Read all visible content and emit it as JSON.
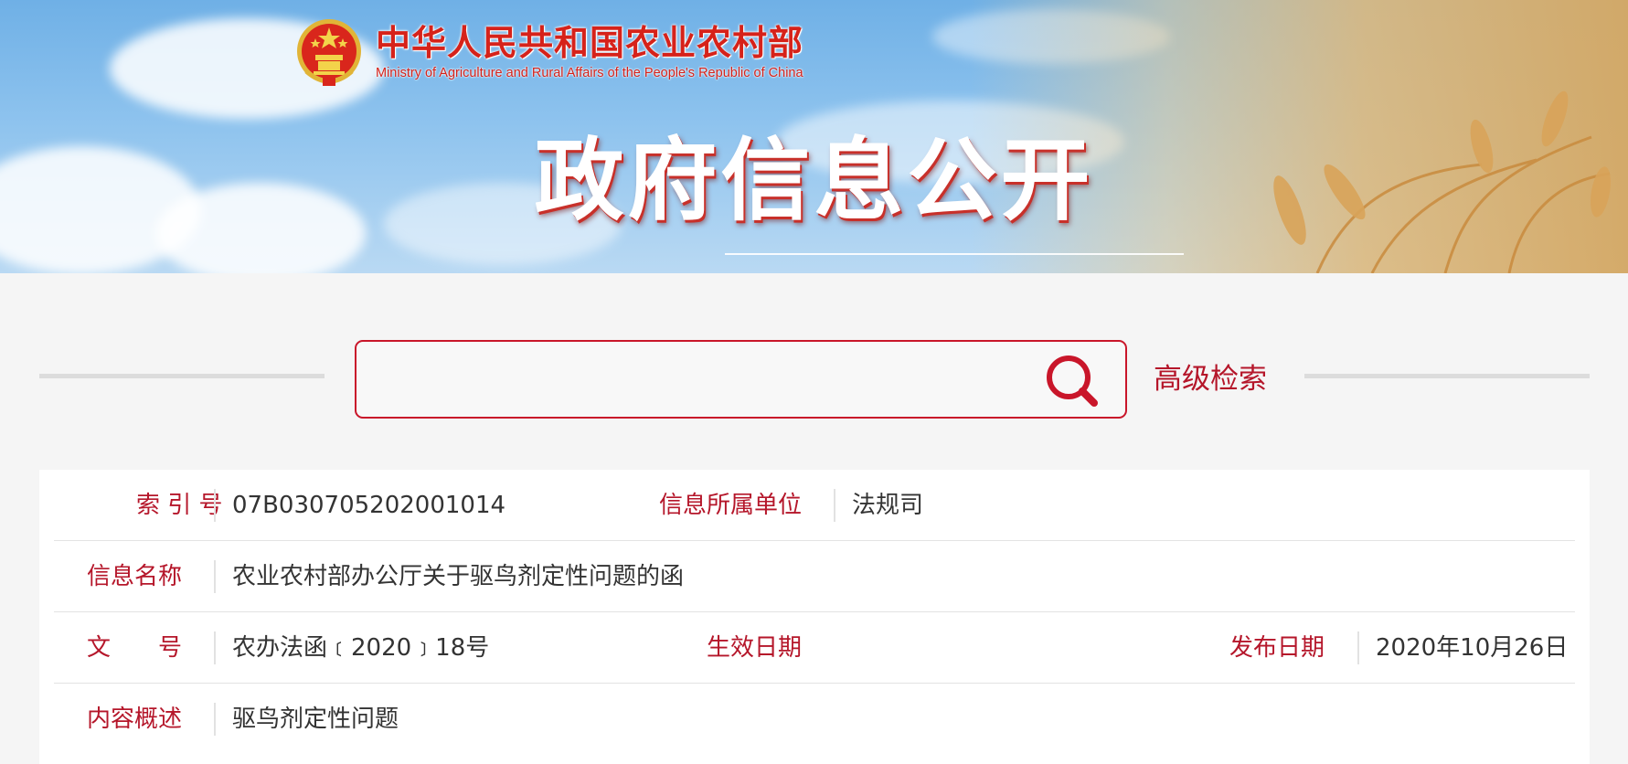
{
  "header": {
    "ministry_cn": "中华人民共和国农业农村部",
    "ministry_en": "Ministry of Agriculture and Rural Affairs of the People's Republic of China",
    "title": "政府信息公开",
    "emblem_icon": "national-emblem-icon"
  },
  "search": {
    "value": "",
    "placeholder": "",
    "button_icon": "search-icon",
    "advanced_label": "高级检索"
  },
  "info": {
    "index_no_label": "索 引 号",
    "index_no_value": "07B030705202001014",
    "unit_label": "信息所属单位",
    "unit_value": "法规司",
    "name_label": "信息名称",
    "name_value": "农业农村部办公厅关于驱鸟剂定性问题的函",
    "doc_no_label": "文　　号",
    "doc_no_value": "农办法函﹝2020﹞18号",
    "effective_label": "生效日期",
    "effective_value": "",
    "publish_label": "发布日期",
    "publish_value": "2020年10月26日",
    "summary_label": "内容概述",
    "summary_value": "驱鸟剂定性问题"
  },
  "colors": {
    "accent_red": "#c9162a",
    "label_red": "#b5162a",
    "text": "#333333",
    "page_bg": "#f5f5f5"
  }
}
